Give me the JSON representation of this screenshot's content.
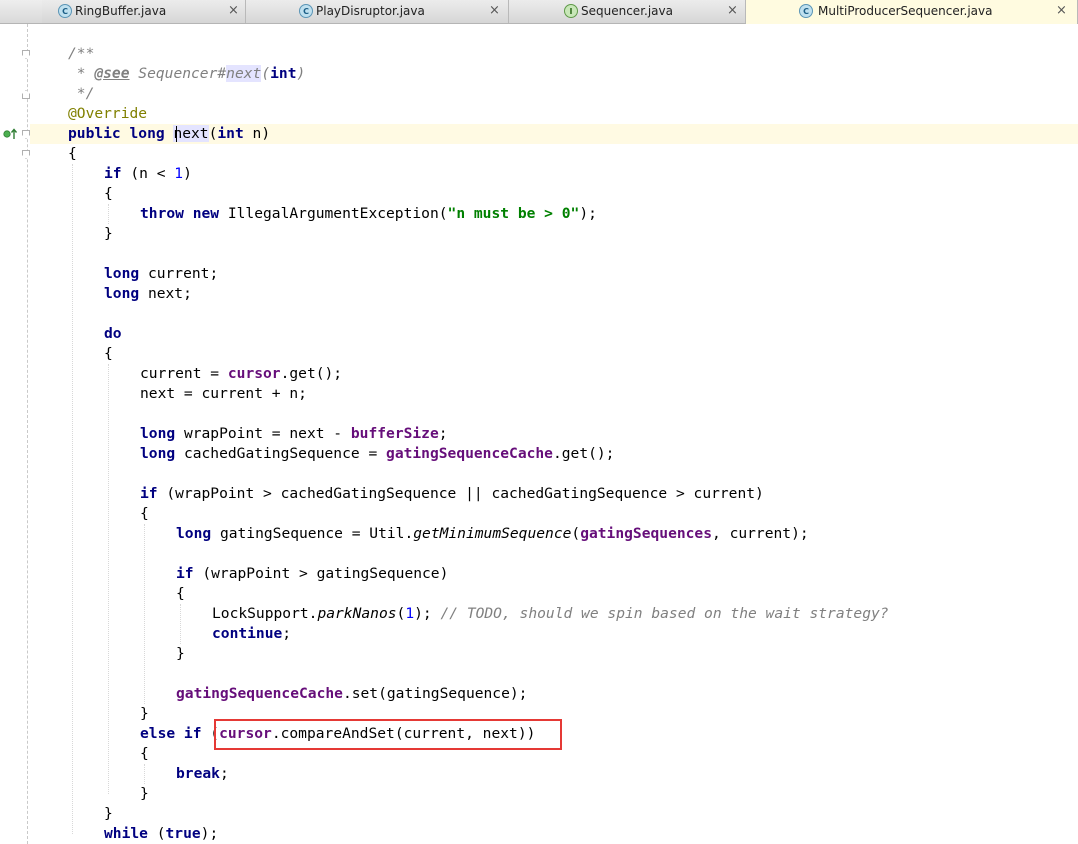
{
  "tabs": [
    {
      "label": "RingBuffer.java",
      "icon": "class-icon",
      "active": false
    },
    {
      "label": "PlayDisruptor.java",
      "icon": "class-icon",
      "active": false
    },
    {
      "label": "Sequencer.java",
      "icon": "interface-icon",
      "active": false
    },
    {
      "label": "MultiProducerSequencer.java",
      "icon": "class-icon",
      "active": true
    }
  ],
  "tab_close_glyph": "×",
  "code": {
    "l1": "/**",
    "l2_star": " * ",
    "l2_tag": "@see",
    "l2_ref_a": " Sequencer#",
    "l2_ref_b": "next",
    "l2_ref_c": "(",
    "l2_ref_int": "int",
    "l2_ref_d": ")",
    "l3": " */",
    "l4": "@Override",
    "l5_kw": "public long ",
    "l5_name": "next",
    "l5_paren": "(",
    "l5_int": "int",
    "l5_rest": " n)",
    "l6": "{",
    "l7_if": "if",
    "l7_a": " (n < ",
    "l7_num": "1",
    "l7_b": ")",
    "l8": "{",
    "l9_throw": "throw new",
    "l9_a": " IllegalArgumentException(",
    "l9_str": "\"n must be > 0\"",
    "l9_b": ");",
    "l10": "}",
    "l11_kw": "long",
    "l11_rest": " current;",
    "l12_kw": "long",
    "l12_rest": " next;",
    "l13": "do",
    "l14": "{",
    "l15_a": "current = ",
    "l15_fld": "cursor",
    "l15_b": ".get();",
    "l16": "next = current + n;",
    "l17_kw": "long",
    "l17_a": " wrapPoint = next - ",
    "l17_fld": "bufferSize",
    "l17_b": ";",
    "l18_kw": "long",
    "l18_a": " cachedGatingSequence = ",
    "l18_fld": "gatingSequenceCache",
    "l18_b": ".get();",
    "l19_if": "if",
    "l19_rest": " (wrapPoint > cachedGatingSequence || cachedGatingSequence > current)",
    "l20": "{",
    "l21_kw": "long",
    "l21_a": " gatingSequence = Util.",
    "l21_method": "getMinimumSequence",
    "l21_b": "(",
    "l21_fld": "gatingSequences",
    "l21_c": ", current);",
    "l22_if": "if",
    "l22_rest": " (wrapPoint > gatingSequence)",
    "l23": "{",
    "l24_a": "LockSupport.",
    "l24_method": "parkNanos",
    "l24_b": "(",
    "l24_num": "1",
    "l24_c": "); ",
    "l24_cmt": "// TODO, should we spin based on the wait strategy?",
    "l25": "continue",
    "l25_semi": ";",
    "l26": "}",
    "l27_fld": "gatingSequenceCache",
    "l27_rest": ".set(gatingSequence);",
    "l28": "}",
    "l29_kw": "else if",
    "l29_a": " (",
    "l29_fld": "cursor",
    "l29_b": ".compareAndSet(current, next))",
    "l30": "{",
    "l31": "break",
    "l31_semi": ";",
    "l32": "}",
    "l33": "}",
    "l34_kw": "while",
    "l34_a": " (",
    "l34_true": "true",
    "l34_b": ");"
  },
  "colors": {
    "keyword": "#000080",
    "field": "#660e7a",
    "number": "#0000ff",
    "string": "#008000",
    "comment": "#808080",
    "annotation": "#808000",
    "highlight_box": "#e53935",
    "caret_row": "#fffae3"
  }
}
